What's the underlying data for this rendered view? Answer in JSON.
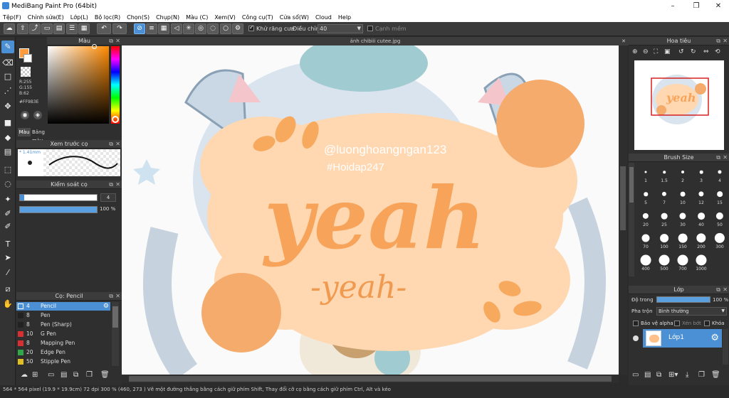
{
  "window": {
    "title": "MediBang Paint Pro (64bit)"
  },
  "menu": [
    "Tệp(F)",
    "Chỉnh sửa(E)",
    "Lớp(L)",
    "Bộ lọc(R)",
    "Chọn(S)",
    "Chụp(N)",
    "Màu (C)",
    "Xem(V)",
    "Công cụ(T)",
    "Cửa sổ(W)",
    "Cloud",
    "Help"
  ],
  "toolbar": {
    "antialias_label": "Khử răng cưa",
    "correction_label": "Điều chỉnh",
    "correction_value": "40",
    "soft_edge_label": "Cạnh mềm"
  },
  "color_panel": {
    "title": "Màu",
    "r": "R:255",
    "g": "G:155",
    "b": "B:62",
    "hex": "#FF9B3E",
    "tab_color": "Màu",
    "tab_palette": "Bảng màu",
    "colors": {
      "primary": "#FF9B3E",
      "hue_marker": "#ff9b3e"
    }
  },
  "preview_panel": {
    "title": "Xem trước cọ",
    "size": "* 1.41mm"
  },
  "brush_control": {
    "title": "Kiểm soát cọ",
    "size_value": "4",
    "opacity_value": "100 %"
  },
  "brush_list": {
    "title": "Cọ: Pencil",
    "items": [
      {
        "num": "4",
        "name": "Pencil",
        "color": "#4b8fd4"
      },
      {
        "num": "8",
        "name": "Pen",
        "color": "#222222"
      },
      {
        "num": "8",
        "name": "Pen (Sharp)",
        "color": "#222222"
      },
      {
        "num": "10",
        "name": "G Pen",
        "color": "#d83030"
      },
      {
        "num": "8",
        "name": "Mapping Pen",
        "color": "#d83030"
      },
      {
        "num": "20",
        "name": "Edge Pen",
        "color": "#2fa84a"
      },
      {
        "num": "50",
        "name": "Stipple Pen",
        "color": "#e0c020"
      }
    ]
  },
  "document": {
    "tab_title": "ảnh chibiii cutee.jpg"
  },
  "canvas": {
    "watermark_line1": "@luonghoangngan123",
    "watermark_line2": "#Hoidap247",
    "big_text": "yeah",
    "small_text": "-yeah-"
  },
  "navigator": {
    "title": "Hoa tiêu"
  },
  "brush_size": {
    "title": "Brush Size",
    "sizes": [
      "1",
      "1.5",
      "2",
      "3",
      "4",
      "5",
      "7",
      "10",
      "12",
      "15",
      "20",
      "25",
      "30",
      "40",
      "50",
      "70",
      "100",
      "150",
      "200",
      "300",
      "400",
      "500",
      "700",
      "1000"
    ]
  },
  "layers": {
    "title": "Lớp",
    "opacity_label": "Độ trong",
    "opacity_value": "100 %",
    "blend_label": "Pha trộn",
    "blend_value": "Bình thường",
    "protect_alpha": "Bảo vệ alpha",
    "clipping": "Xén bớt",
    "lock": "Khóa",
    "layer_name": "Lớp1"
  },
  "status": "564 * 564 pixel    (19.9 * 19.9cm)   72 dpi   300 %   (460, 273 )   Vẽ một đường thẳng bằng cách giữ phím Shift, Thay đổi cỡ cọ bằng cách giữ phím Ctrl, Alt và kéo"
}
